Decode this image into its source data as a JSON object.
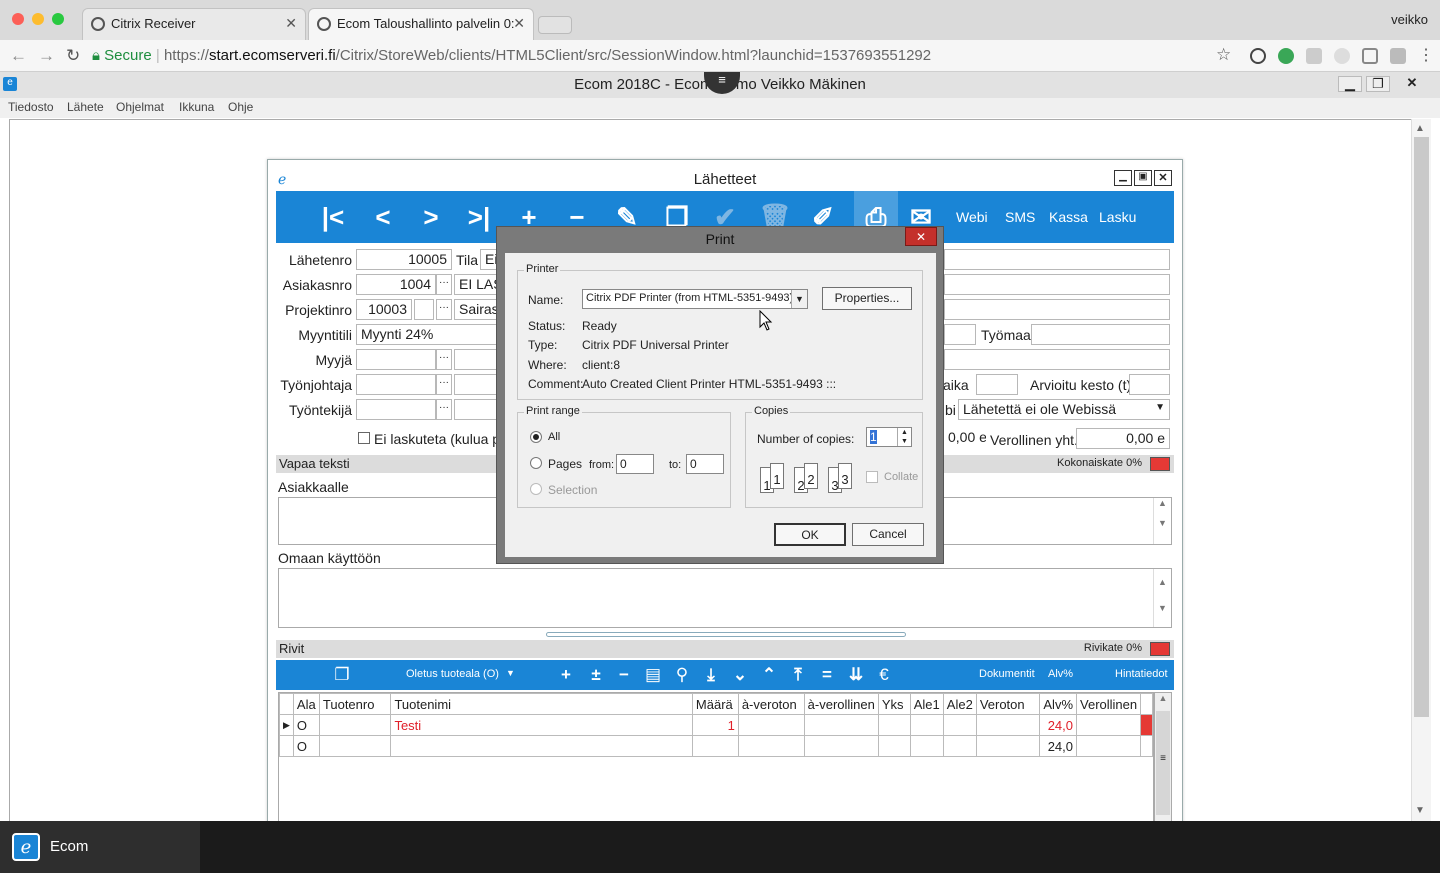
{
  "browser": {
    "user": "veikko",
    "tabs": [
      {
        "title": "Citrix Receiver",
        "active": false
      },
      {
        "title": "Ecom Taloushallinto palvelin 0:",
        "active": true
      }
    ],
    "secure_label": "Secure",
    "url_scheme": "https://",
    "url_host": "start.ecomserveri.fi",
    "url_path": "/Citrix/StoreWeb/clients/HTML5Client/src/SessionWindow.html?launchid=1537693551292"
  },
  "app": {
    "title": "Ecom 2018C - Ecom Demo Veikko Mäkinen",
    "menu": [
      "Tiedosto",
      "Lähete",
      "Ohjelmat",
      "Ikkuna",
      "Ohje"
    ]
  },
  "lahetteet": {
    "title": "Lähetteet",
    "toolbar_text": [
      "Webi",
      "SMS",
      "Kassa",
      "Lasku"
    ],
    "labels": {
      "lahetenro": "Lähetenro",
      "tila": "Tila",
      "asiakasnro": "Asiakasnro",
      "projektinro": "Projektinro",
      "myyntitili": "Myyntitili",
      "myyja": "Myyjä",
      "tyonjohtaja": "Työnjohtaja",
      "tyontekija": "Työntekijä",
      "tyomaa": "Työmaa",
      "aika": "aika",
      "arvioitu_kesto": "Arvioitu kesto (t)",
      "bi": "bi",
      "ei_laskuteta": "Ei laskuteta (kulua pr",
      "verollinen_yht": "Verollinen yht.",
      "vapaa_teksti": "Vapaa teksti",
      "kokonaiskate": "Kokonaiskate 0%",
      "asiakkaalle": "Asiakkaalle",
      "omaan_kayttoon": "Omaan käyttöön",
      "rivit": "Rivit",
      "rivikate": "Rivikate 0%"
    },
    "values": {
      "lahetenro": "10005",
      "tila": "Ei",
      "asiakasnro": "1004",
      "asiakas_name": "EI LAS",
      "projektinro": "10003",
      "projekti_name": "Sairast",
      "myyntitili": "Myynti 24%",
      "webi_status": "Lähetettä ei ole Webissä",
      "total_left": "0,00 e",
      "verollinen_yht": "0,00 e"
    },
    "grid_toolbar": {
      "tuoteala": "Oletus tuoteala (O)",
      "dokumentit": "Dokumentit",
      "alv": "Alv%",
      "hintatiedot": "Hintatiedot"
    },
    "grid": {
      "columns": [
        "Ala",
        "Tuotenro",
        "Tuotenimi",
        "Määrä",
        "à-veroton",
        "à-verollinen",
        "Yks",
        "Ale1",
        "Ale2",
        "Veroton",
        "Alv%",
        "Verollinen"
      ],
      "rows": [
        [
          "O",
          "",
          "Testi",
          "1",
          "",
          "",
          "",
          "",
          "",
          "",
          "24,0",
          ""
        ],
        [
          "O",
          "",
          "",
          "",
          "",
          "",
          "",
          "",
          "",
          "",
          "24,0",
          ""
        ]
      ]
    }
  },
  "print_dialog": {
    "title": "Print",
    "printer_group": "Printer",
    "name_label": "Name:",
    "name_value": "Citrix PDF Printer (from HTML-5351-9493) in",
    "properties_button": "Properties...",
    "status_label": "Status:",
    "status_value": "Ready",
    "type_label": "Type:",
    "type_value": "Citrix PDF Universal Printer",
    "where_label": "Where:",
    "where_value": "client:8",
    "comment_label": "Comment:",
    "comment_value": "Auto Created Client Printer HTML-5351-9493 :::",
    "range_group": "Print range",
    "all_label": "All",
    "pages_label": "Pages",
    "from_label": "from:",
    "from_value": "0",
    "to_label": "to:",
    "to_value": "0",
    "selection_label": "Selection",
    "copies_group": "Copies",
    "copies_label": "Number of copies:",
    "copies_value": "1",
    "collate_label": "Collate",
    "ok_button": "OK",
    "cancel_button": "Cancel"
  },
  "taskbar": {
    "app_label": "Ecom"
  },
  "colors": {
    "toolbar_blue": "#1a85d6",
    "red_flag": "#e53935",
    "row_text_red": "#e0202a"
  }
}
